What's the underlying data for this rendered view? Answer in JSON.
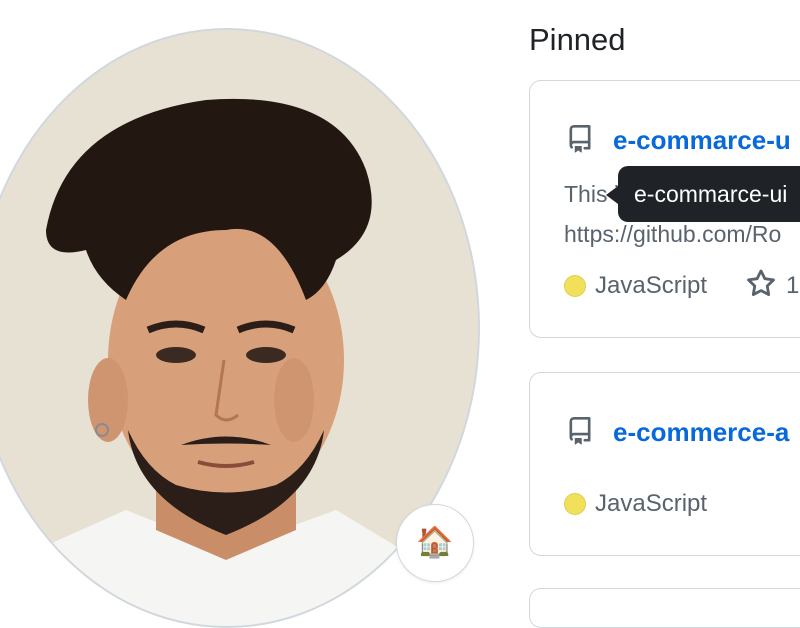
{
  "profile": {
    "status_emoji": "🏠"
  },
  "pinned": {
    "title": "Pinned",
    "repos": [
      {
        "name": "e-commarce-u",
        "description_line1": "This i",
        "description_line2": "https://github.com/Ro",
        "language": "JavaScript",
        "stars": "1"
      },
      {
        "name": "e-commerce-a",
        "language": "JavaScript"
      }
    ]
  },
  "tooltip": {
    "text": "e-commarce-ui"
  },
  "colors": {
    "link": "#0969da",
    "javascript": "#f1e05a",
    "tooltip_bg": "#1f2328",
    "border": "#d0d7de"
  },
  "icons": [
    "repo-icon",
    "star-icon",
    "house-emoji"
  ]
}
